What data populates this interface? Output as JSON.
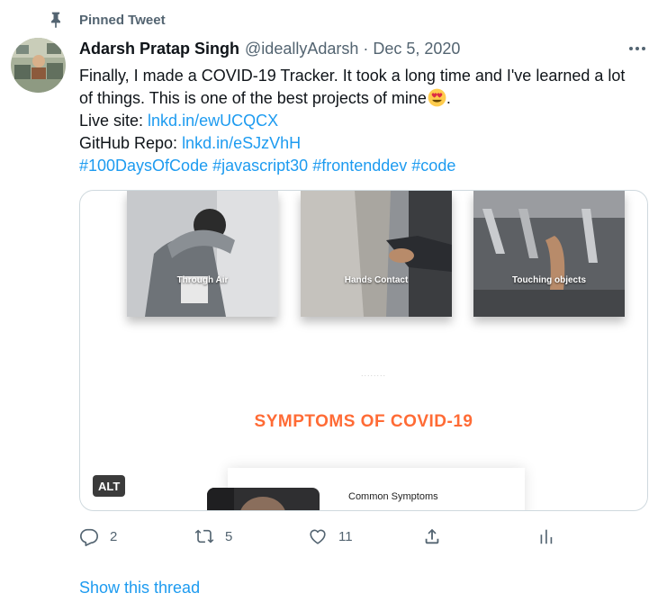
{
  "pinned": {
    "label": "Pinned Tweet",
    "icon": "pin-icon"
  },
  "tweet": {
    "author_name": "Adarsh Pratap Singh",
    "handle": "@ideallyAdarsh",
    "separator": "·",
    "date": "Dec 5, 2020",
    "more_icon": "more-icon",
    "text_line1": "Finally, I made a COVID-19 Tracker. It took a long time and I've learned a lot",
    "text_line2": "of things. This is one of the best projects of mine",
    "emoji": "heart-eyes-emoji",
    "text_line2_end": ".",
    "live_site_label": "Live site: ",
    "live_site_link": "lnkd.in/ewUCQCX",
    "github_label": "GitHub Repo: ",
    "github_link": "lnkd.in/eSJzVhH",
    "hashtags": [
      "#100DaysOfCode",
      "#javascript30",
      " #frontenddev",
      "#code"
    ]
  },
  "media": {
    "cards": [
      {
        "label": "Through Air"
      },
      {
        "label": "Hands Contact"
      },
      {
        "label": "Touching objects"
      }
    ],
    "separator_dots": "........",
    "section_title": "SYMPTOMS OF COVID-19",
    "panel_label": "Common Symptoms",
    "alt_badge": "ALT"
  },
  "actions": {
    "reply_count": "2",
    "retweet_count": "5",
    "like_count": "11",
    "icons": [
      "reply-icon",
      "retweet-icon",
      "like-icon",
      "share-icon",
      "analytics-icon"
    ]
  },
  "show_thread": "Show this thread",
  "colors": {
    "link": "#1d9bf0",
    "secondary": "#536471",
    "title_orange": "#ff6b35",
    "border": "#cfd9de"
  }
}
